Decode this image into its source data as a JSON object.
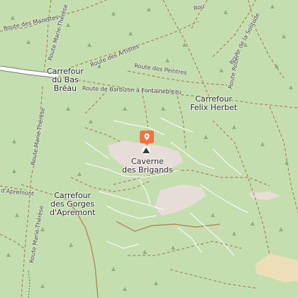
{
  "colors": {
    "forest": "#c5deb0",
    "track": "#b08a5a",
    "path": "#ffffff",
    "main_road": "#ffffff",
    "rock_area": "#e8dcd8",
    "sand": "#f0e6c2",
    "pin": "#f2733e"
  },
  "marker": {
    "icon": "map-pin-icon"
  },
  "places": {
    "carrefour_bas_breau": "Carrefour\ndu Bas\nBréau",
    "carrefour_felix_herbet": "Carrefour\nFelix Herbet",
    "caverne_brigands": "Caverne\ndes Brigands",
    "carrefour_gorges_apremont": "Carrefour\ndes Gorges\nd'Apremont"
  },
  "roads": {
    "mazettes": "Route des Mazettes",
    "marie_therese_top": "Route Marie-Thérèse",
    "artistes": "Route des Artistes",
    "peintres": "Route des Peintres",
    "solitude": "Route de la Solitude",
    "robert": "Route Robert",
    "barbizon": "Route de Barbizon à Fontainebleau",
    "marie_therese_mid": "Route Marie-Thérèse",
    "apremont": "d'Apremont",
    "marie_therese_low": "Route Marie-Thérèse",
    "partial_top": "Rou"
  }
}
